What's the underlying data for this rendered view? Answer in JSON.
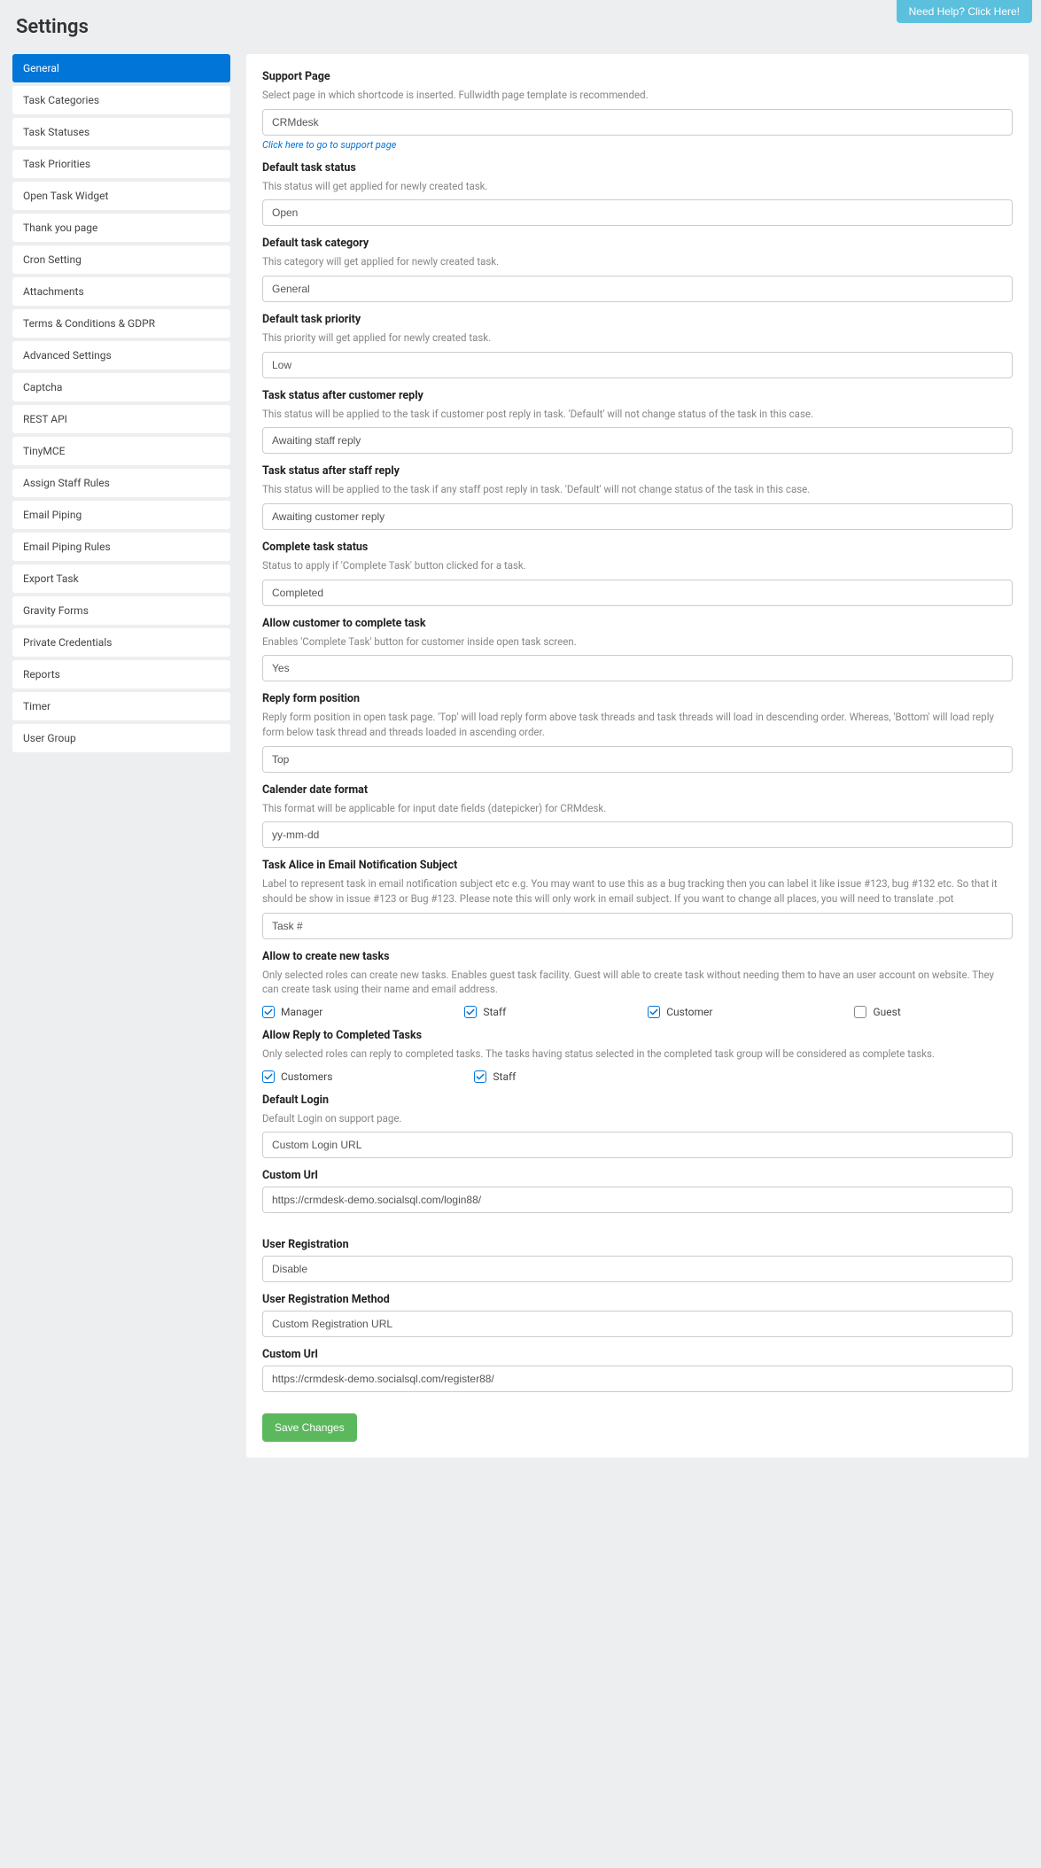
{
  "help_button": "Need Help? Click Here!",
  "page_title": "Settings",
  "sidebar": {
    "items": [
      {
        "label": "General",
        "active": true
      },
      {
        "label": "Task Categories",
        "active": false
      },
      {
        "label": "Task Statuses",
        "active": false
      },
      {
        "label": "Task Priorities",
        "active": false
      },
      {
        "label": "Open Task Widget",
        "active": false
      },
      {
        "label": "Thank you page",
        "active": false
      },
      {
        "label": "Cron Setting",
        "active": false
      },
      {
        "label": "Attachments",
        "active": false
      },
      {
        "label": "Terms & Conditions & GDPR",
        "active": false
      },
      {
        "label": "Advanced Settings",
        "active": false
      },
      {
        "label": "Captcha",
        "active": false
      },
      {
        "label": "REST API",
        "active": false
      },
      {
        "label": "TinyMCE",
        "active": false
      },
      {
        "label": "Assign Staff Rules",
        "active": false
      },
      {
        "label": "Email Piping",
        "active": false
      },
      {
        "label": "Email Piping Rules",
        "active": false
      },
      {
        "label": "Export Task",
        "active": false
      },
      {
        "label": "Gravity Forms",
        "active": false
      },
      {
        "label": "Private Credentials",
        "active": false
      },
      {
        "label": "Reports",
        "active": false
      },
      {
        "label": "Timer",
        "active": false
      },
      {
        "label": "User Group",
        "active": false
      }
    ]
  },
  "fields": {
    "support_page": {
      "label": "Support Page",
      "desc": "Select page in which shortcode is inserted. Fullwidth page template is recommended.",
      "value": "CRMdesk",
      "link": "Click here to go to support page"
    },
    "default_task_status": {
      "label": "Default task status",
      "desc": "This status will get applied for newly created task.",
      "value": "Open"
    },
    "default_task_category": {
      "label": "Default task category",
      "desc": "This category will get applied for newly created task.",
      "value": "General"
    },
    "default_task_priority": {
      "label": "Default task priority",
      "desc": "This priority will get applied for newly created task.",
      "value": "Low"
    },
    "status_after_customer_reply": {
      "label": "Task status after customer reply",
      "desc": "This status will be applied to the task if customer post reply in task. 'Default' will not change status of the task in this case.",
      "value": "Awaiting staff reply"
    },
    "status_after_staff_reply": {
      "label": "Task status after staff reply",
      "desc": "This status will be applied to the task if any staff post reply in task. 'Default' will not change status of the task in this case.",
      "value": "Awaiting customer reply"
    },
    "complete_task_status": {
      "label": "Complete task status",
      "desc": "Status to apply if 'Complete Task' button clicked for a task.",
      "value": "Completed"
    },
    "allow_customer_complete": {
      "label": "Allow customer to complete task",
      "desc": "Enables 'Complete Task' button for customer inside open task screen.",
      "value": "Yes"
    },
    "reply_form_position": {
      "label": "Reply form position",
      "desc": "Reply form position in open task page. 'Top' will load reply form above task threads and task threads will load in descending order. Whereas, 'Bottom' will load reply form below task thread and threads loaded in ascending order.",
      "value": "Top"
    },
    "calendar_date_format": {
      "label": "Calender date format",
      "desc": "This format will be applicable for input date fields (datepicker) for CRMdesk.",
      "value": "yy-mm-dd"
    },
    "task_alice": {
      "label": "Task Alice in Email Notification Subject",
      "desc": "Label to represent task in email notification subject etc e.g. You may want to use this as a bug tracking then you can label it like issue #123, bug #132 etc. So that it should be show in issue #123 or Bug #123. Please note this will only work in email subject. If you want to change all places, you will need to translate .pot",
      "value": "Task #"
    },
    "allow_create_tasks": {
      "label": "Allow to create new tasks",
      "desc": "Only selected roles can create new tasks. Enables guest task facility. Guest will able to create task without needing them to have an user account on website. They can create task using their name and email address.",
      "options": [
        {
          "label": "Manager",
          "checked": true
        },
        {
          "label": "Staff",
          "checked": true
        },
        {
          "label": "Customer",
          "checked": true
        },
        {
          "label": "Guest",
          "checked": false
        }
      ]
    },
    "allow_reply_completed": {
      "label": "Allow Reply to Completed Tasks",
      "desc": "Only selected roles can reply to completed tasks. The tasks having status selected in the completed task group will be considered as complete tasks.",
      "options": [
        {
          "label": "Customers",
          "checked": true
        },
        {
          "label": "Staff",
          "checked": true
        }
      ]
    },
    "default_login": {
      "label": "Default Login",
      "desc": "Default Login on support page.",
      "value": "Custom Login URL"
    },
    "custom_url_login": {
      "label": "Custom Url",
      "value": "https://crmdesk-demo.socialsql.com/login88/"
    },
    "user_registration": {
      "label": "User Registration",
      "value": "Disable"
    },
    "user_registration_method": {
      "label": "User Registration Method",
      "value": "Custom Registration URL"
    },
    "custom_url_register": {
      "label": "Custom Url",
      "value": "https://crmdesk-demo.socialsql.com/register88/"
    }
  },
  "save_button": "Save Changes"
}
